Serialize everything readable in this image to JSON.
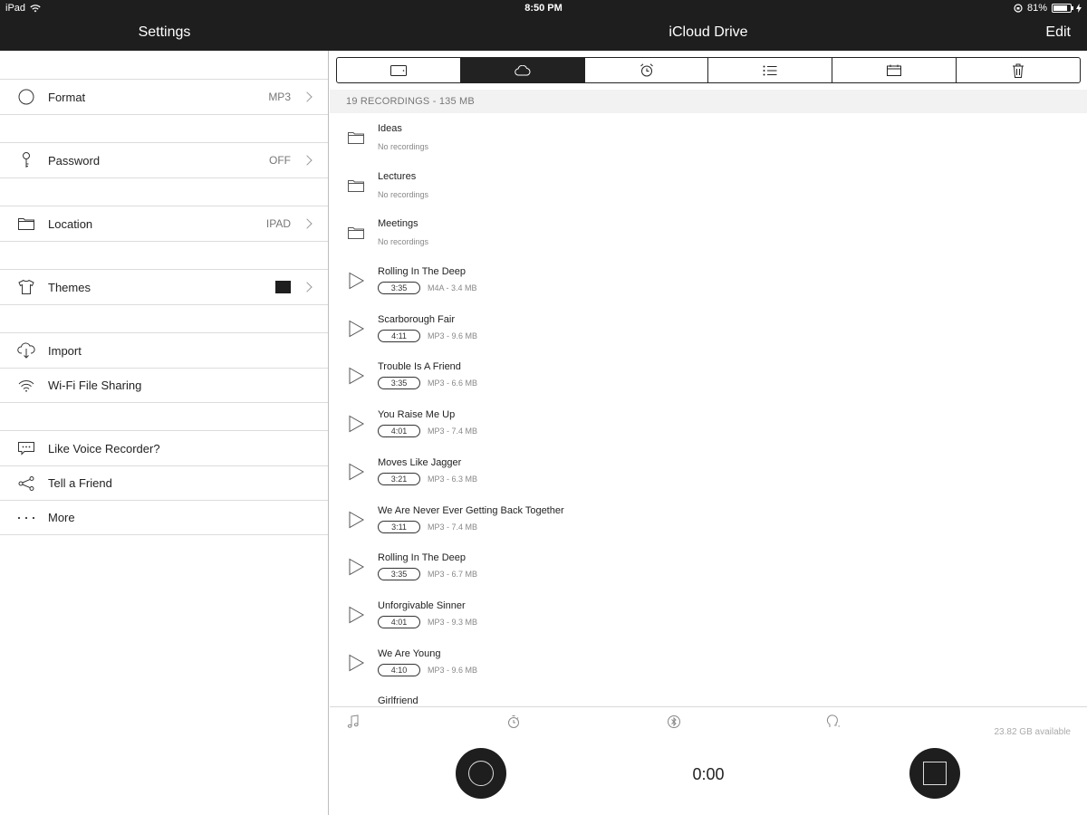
{
  "status": {
    "device": "iPad",
    "time": "8:50 PM",
    "battery": "81%",
    "battery_fraction": 0.81
  },
  "nav": {
    "settings_title": "Settings",
    "main_title": "iCloud Drive",
    "edit_label": "Edit"
  },
  "settings": {
    "format": {
      "label": "Format",
      "value": "MP3",
      "icon": "circle-icon"
    },
    "password": {
      "label": "Password",
      "value": "OFF",
      "icon": "key-icon"
    },
    "location": {
      "label": "Location",
      "value": "IPAD",
      "icon": "folder-icon"
    },
    "themes": {
      "label": "Themes",
      "icon": "tshirt-icon",
      "swatch_color": "#1e1e1e"
    },
    "import": {
      "label": "Import",
      "icon": "cloud-download-icon"
    },
    "wifi": {
      "label": "Wi-Fi File Sharing",
      "icon": "wifi-icon"
    },
    "like": {
      "label": "Like Voice Recorder?",
      "icon": "chat-icon"
    },
    "tell": {
      "label": "Tell a Friend",
      "icon": "share-icon"
    },
    "more": {
      "label": "More",
      "icon": "ellipsis-icon"
    }
  },
  "tabs": [
    "device-icon",
    "cloud-icon",
    "alarm-icon",
    "list-icon",
    "calendar-icon",
    "trash-icon"
  ],
  "section": {
    "header": "19 RECORDINGS - 135 MB"
  },
  "folders": [
    {
      "name": "Ideas",
      "sub": "No recordings"
    },
    {
      "name": "Lectures",
      "sub": "No recordings"
    },
    {
      "name": "Meetings",
      "sub": "No recordings"
    }
  ],
  "recordings": [
    {
      "name": "Rolling In The Deep",
      "duration": "3:35",
      "info": "M4A - 3.4 MB"
    },
    {
      "name": "Scarborough Fair",
      "duration": "4:11",
      "info": "MP3 - 9.6 MB"
    },
    {
      "name": "Trouble Is A Friend",
      "duration": "3:35",
      "info": "MP3 - 6.6 MB"
    },
    {
      "name": "You Raise Me Up",
      "duration": "4:01",
      "info": "MP3 - 7.4 MB"
    },
    {
      "name": "Moves Like Jagger",
      "duration": "3:21",
      "info": "MP3 - 6.3 MB"
    },
    {
      "name": "We Are Never Ever Getting Back Together",
      "duration": "3:11",
      "info": "MP3 - 7.4 MB"
    },
    {
      "name": "Rolling In The Deep",
      "duration": "3:35",
      "info": "MP3 - 6.7 MB"
    },
    {
      "name": "Unforgivable Sinner",
      "duration": "4:01",
      "info": "MP3 - 9.3 MB"
    },
    {
      "name": "We Are Young",
      "duration": "4:10",
      "info": "MP3 - 9.6 MB"
    },
    {
      "name": "Girlfriend",
      "duration": "",
      "info": ""
    }
  ],
  "bottom": {
    "available": "23.82 GB available",
    "timer": "0:00"
  }
}
